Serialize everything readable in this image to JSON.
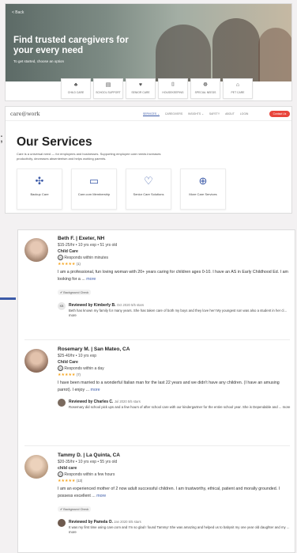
{
  "hero": {
    "back": "< Back",
    "headline": "Find trusted caregivers for your every need",
    "subtitle": "To get started, choose an option",
    "categories": [
      {
        "icon": "stroller-icon",
        "glyph": "♣",
        "label": "CHILD CARE"
      },
      {
        "icon": "school-support-icon",
        "glyph": "▤",
        "label": "SCHOOL SUPPORT"
      },
      {
        "icon": "senior-care-icon",
        "glyph": "♥",
        "label": "SENIOR CARE"
      },
      {
        "icon": "housekeeping-icon",
        "glyph": "⌷",
        "label": "HOUSEKEEPING"
      },
      {
        "icon": "special-needs-icon",
        "glyph": "☸",
        "label": "SPECIAL NEEDS"
      },
      {
        "icon": "pet-care-icon",
        "glyph": "⌂",
        "label": "PET CARE"
      }
    ]
  },
  "services": {
    "logo": "care@work",
    "nav": [
      "SERVICES ⌄",
      "CAREGIVERS",
      "INSIGHTS ⌄",
      "SAFETY",
      "ABOUT",
      "LOGIN"
    ],
    "join_label": "Contact Us",
    "title": "Our Services",
    "description": "Care is a universal need — for employees and businesses. Supporting employee care needs increases productivity, decreases absenteeism and helps working parents.",
    "cards": [
      {
        "icon": "backup-care-icon",
        "glyph": "✣",
        "label": "Backup Care"
      },
      {
        "icon": "membership-icon",
        "glyph": "▭",
        "label": "Care.com Membership"
      },
      {
        "icon": "senior-care-icon",
        "glyph": "♡",
        "label": "Senior Care Solutions"
      },
      {
        "icon": "more-care-icon",
        "glyph": "⊕",
        "label": "More Care Services"
      }
    ],
    "side_glyph": ";"
  },
  "caregivers": [
    {
      "name": "Beth F. | Exeter, NH",
      "rate": "$15-25/hr • 10 yrs exp • 51 yrs old",
      "type": "Child Care",
      "response": "Responds within minutes",
      "stars": "★★★★★",
      "count": "(1)",
      "bio": "I am a professional, fun loving woman with 20+ years caring for children ages 0-10. I have an AS in Early Childhood Ed. I am looking for a ...",
      "more": "more",
      "badge": "Background Check",
      "review_initials": "KB",
      "reviewer": "Reviewed by Kimberly B.",
      "review_date": "Oct 2020 5/5 stars",
      "review_text": "Beth has known my family for many years. She has taken care of both my boys and they love her! My youngest son was also a student in her cl... more",
      "avatar_color": "#a48672"
    },
    {
      "name": "Rosemary M. | San Mateo, CA",
      "rate": "$25-40/hr • 10 yrs exp",
      "type": "Child Care",
      "response": "Responds within a day",
      "stars": "★★★★★",
      "count": "(7)",
      "bio": "I have been married to a wonderful Italian man for the last 22 years and we didn't have any children. (I have an amusing parrot). I enjoy ...",
      "more": "more",
      "badge": "",
      "review_initials": "",
      "reviewer": "Reviewed by Charles C.",
      "review_date": "Jul 2020 5/5 stars",
      "review_text": "Rosemary did school pick ups and a few hours of after school care with our kindergartner for the entire school year. She is Dependable and ... more",
      "avatar_color": "#9b7a66"
    },
    {
      "name": "Tammy D. | La Quinta, CA",
      "rate": "$20-35/hr • 10 yrs exp • 55 yrs old",
      "type": "child care",
      "response": "Responds within a few hours",
      "stars": "★★★★★",
      "count": "(13)",
      "bio": "I am an experienced mother of 2 now adult successful children. I am trustworthy, ethical, patient and morally grounded. I possess excellent ...",
      "more": "more",
      "badge": "Background Check",
      "review_initials": "",
      "reviewer": "Reviewed by Pamela O.",
      "review_date": "Jan 2020 5/5 stars",
      "review_text": "It was my first time using care.com and I'm so glad I found Tammy! She was amazing and helped us to babysit my one year old daughter and my ... more",
      "avatar_color": "#b89a80"
    }
  ],
  "colors": {
    "accent": "#3b5aa8",
    "cta": "#e8453c",
    "stars": "#f5a623"
  }
}
